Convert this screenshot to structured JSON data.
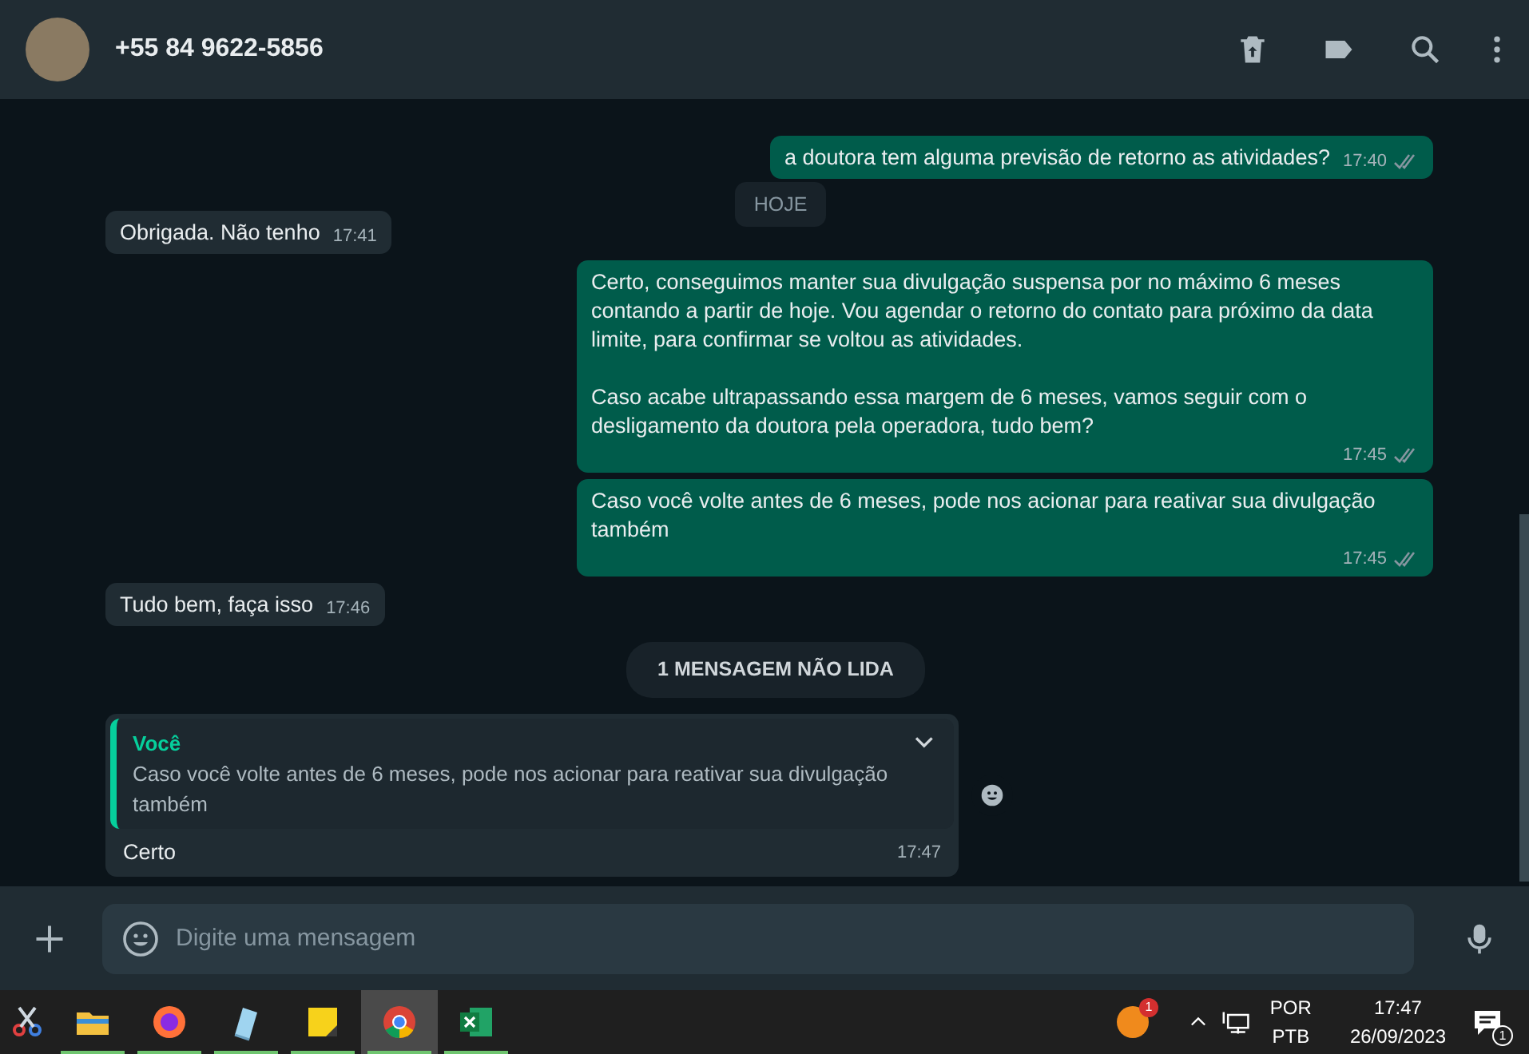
{
  "header": {
    "contact": "+55 84 9622-5856"
  },
  "messages": [
    {
      "kind": "outgoing",
      "text": "a doutora tem alguma previsão de retorno as atividades?",
      "time": "17:40",
      "read": false
    },
    {
      "kind": "date",
      "text": "HOJE"
    },
    {
      "kind": "incoming",
      "text": "Obrigada. Não tenho",
      "time": "17:41"
    },
    {
      "kind": "outgoing",
      "text": "Certo, conseguimos manter sua divulgação suspensa por no máximo 6 meses contando a partir de hoje. Vou agendar o retorno do contato para próximo da data limite, para confirmar se voltou as atividades.\n\nCaso acabe ultrapassando essa margem de 6 meses, vamos seguir com o desligamento da doutora pela operadora, tudo bem?",
      "time": "17:45",
      "read": false
    },
    {
      "kind": "outgoing",
      "text": "Caso você volte antes de 6 meses, pode nos acionar para reativar sua divulgação também",
      "time": "17:45",
      "read": false
    },
    {
      "kind": "incoming",
      "text": "Tudo bem, faça isso",
      "time": "17:46"
    },
    {
      "kind": "unread",
      "text": "1 MENSAGEM NÃO LIDA"
    },
    {
      "kind": "reply",
      "quote_author": "Você",
      "quote_text": "Caso você volte antes de 6 meses, pode nos acionar para reativar sua divulgação também",
      "text": "Certo",
      "time": "17:47"
    }
  ],
  "composer": {
    "placeholder": "Digite uma mensagem"
  },
  "taskbar": {
    "apps": [
      {
        "selected": false,
        "running": false
      },
      {
        "selected": false,
        "running": true
      },
      {
        "selected": false,
        "running": true
      },
      {
        "selected": false,
        "running": true
      },
      {
        "selected": false,
        "running": true
      },
      {
        "selected": true,
        "running": true
      },
      {
        "selected": false,
        "running": true
      }
    ],
    "tray_badge": "1",
    "language": "POR",
    "layout": "PTB",
    "time": "17:47",
    "date": "26/09/2023",
    "notifications": "1"
  }
}
